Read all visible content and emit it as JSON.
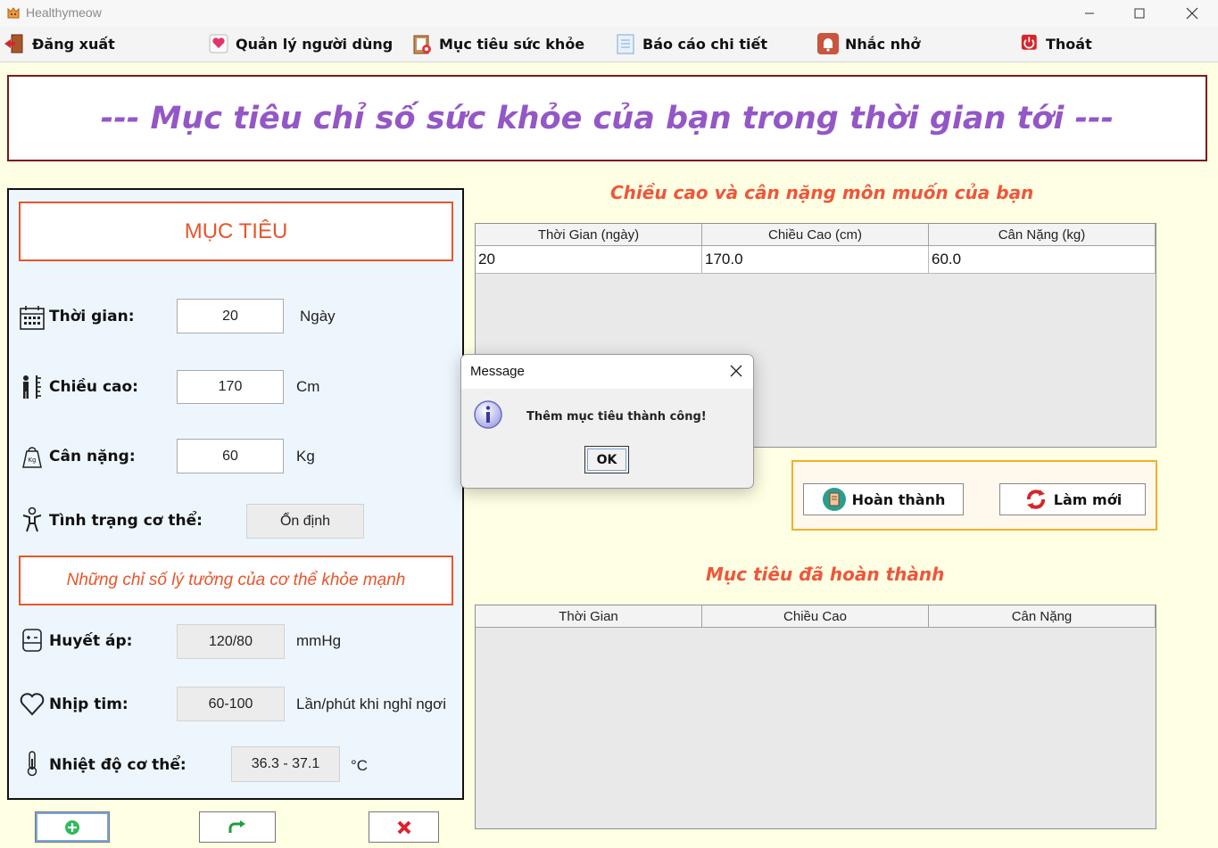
{
  "window": {
    "title": "Healthymeow",
    "controls": [
      "minimize",
      "maximize",
      "close"
    ]
  },
  "menu": [
    {
      "label": "Đăng xuất",
      "icon": "logout-door-icon"
    },
    {
      "label": "Quản lý người dùng",
      "icon": "heart-card-icon"
    },
    {
      "label": "Mục tiêu sức khỏe",
      "icon": "clipboard-target-icon"
    },
    {
      "label": "Báo cáo chi tiết",
      "icon": "report-sheet-icon"
    },
    {
      "label": "Nhắc nhở",
      "icon": "bell-icon"
    },
    {
      "label": "Thoát",
      "icon": "power-icon"
    }
  ],
  "banner": {
    "text": "--- Mục tiêu chỉ số sức khỏe của bạn trong thời gian tới ---"
  },
  "left_panel": {
    "goal_title": "MỤC TIÊU",
    "fields": [
      {
        "label": "Thời gian:",
        "value": "20",
        "unit": "Ngày",
        "icon": "calendar-icon"
      },
      {
        "label": "Chiều cao:",
        "value": "170",
        "unit": "Cm",
        "icon": "height-ruler-icon"
      },
      {
        "label": "Cân nặng:",
        "value": "60",
        "unit": "Kg",
        "icon": "weight-scale-icon"
      },
      {
        "label": "Tình trạng cơ thể:",
        "value": "Ổn định",
        "unit": "",
        "icon": "body-figure-icon"
      }
    ],
    "ideal_title": "Những chỉ số lý tưởng của cơ thể khỏe mạnh",
    "ideal_fields": [
      {
        "label": "Huyết áp:",
        "value": "120/80",
        "unit": "mmHg",
        "icon": "blood-pressure-icon"
      },
      {
        "label": "Nhịp tim:",
        "value": "60-100",
        "unit": "Lần/phút khi nghỉ ngơi",
        "icon": "heart-outline-icon"
      },
      {
        "label": "Nhiệt độ cơ thể:",
        "value": "36.3 - 37.1",
        "unit": "°C",
        "icon": "thermometer-icon"
      }
    ]
  },
  "bottom_buttons": [
    {
      "name": "add",
      "icon": "plus-circle-icon"
    },
    {
      "name": "redo",
      "icon": "redo-arrow-icon"
    },
    {
      "name": "delete",
      "icon": "red-x-icon"
    }
  ],
  "target_section": {
    "heading": "Chiều cao và cân nặng môn muốn của bạn",
    "columns": [
      "Thời Gian (ngày)",
      "Chiều Cao (cm)",
      "Cân Nặng (kg)"
    ],
    "rows": [
      [
        "20",
        "170.0",
        "60.0"
      ]
    ]
  },
  "actions": {
    "complete": {
      "label": "Hoàn thành",
      "icon": "clipboard-check-icon"
    },
    "refresh": {
      "label": "Làm mới",
      "icon": "refresh-icon"
    }
  },
  "done_section": {
    "heading": "Mục tiêu đã hoàn thành",
    "columns": [
      "Thời Gian",
      "Chiều Cao",
      "Cân Nặng"
    ],
    "rows": []
  },
  "dialog": {
    "title": "Message",
    "message": "Thêm mục tiêu thành công!",
    "ok_label": "OK",
    "icon": "info-icon"
  }
}
